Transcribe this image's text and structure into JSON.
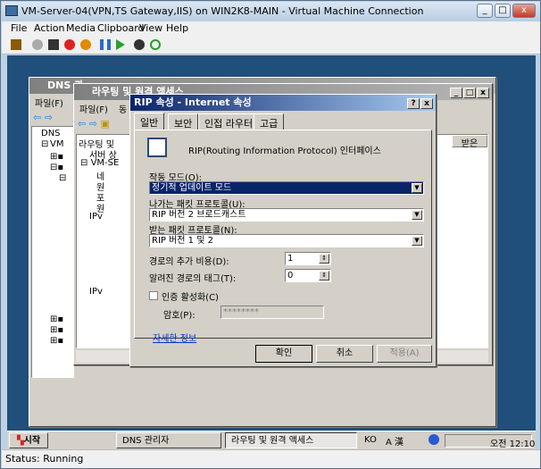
{
  "vm": {
    "title": "VM-Server-04(VPN,TS Gateway,IIS) on WIN2K8-MAIN - Virtual Machine Connection",
    "menu": [
      "File",
      "Action",
      "Media",
      "Clipboard",
      "View",
      "Help"
    ],
    "status": "Status: Running"
  },
  "dns": {
    "title": "DNS 관",
    "menu": "파일(F)",
    "tree_root": "DNS",
    "tree_vm": "VM"
  },
  "rras": {
    "title": "라우팅 및 원격 액세스",
    "menu1": "파일(F)",
    "menu2": "동",
    "tree": [
      "라우팅 및",
      "서버 상",
      "VM-SE",
      "네",
      "원",
      "포",
      "원",
      "IPv",
      "IPv"
    ],
    "col": "받은"
  },
  "dialog": {
    "title": "RIP 속성 - Internet 속성",
    "tabs": [
      "일반",
      "보안",
      "인접 라우터",
      "고급"
    ],
    "header": "RIP(Routing Information Protocol) 인터페이스",
    "mode_label": "작동 모드(O):",
    "mode_value": "정기적 업데이트 모드",
    "out_label": "나가는 패킷 프로토콜(U):",
    "out_value": "RIP 버전 2 브로드캐스트",
    "in_label": "받는 패킷 프로토콜(N):",
    "in_value": "RIP 버전 1 및 2",
    "cost_label": "경로의 추가 비용(D):",
    "cost_value": "1",
    "tag_label": "알려진 경로의 태그(T):",
    "tag_value": "0",
    "auth_label": "인증 활성화(C)",
    "pw_label": "암호(P):",
    "pw_value": "********",
    "more": "자세한 정보",
    "ok": "확인",
    "cancel": "취소",
    "apply": "적용(A)"
  },
  "taskbar": {
    "start": "시작",
    "t1": "DNS 관리자",
    "t2": "라우팅 및 원격 액세스",
    "lang": "KO",
    "ime": "A 漢",
    "time": "오전 12:10"
  }
}
